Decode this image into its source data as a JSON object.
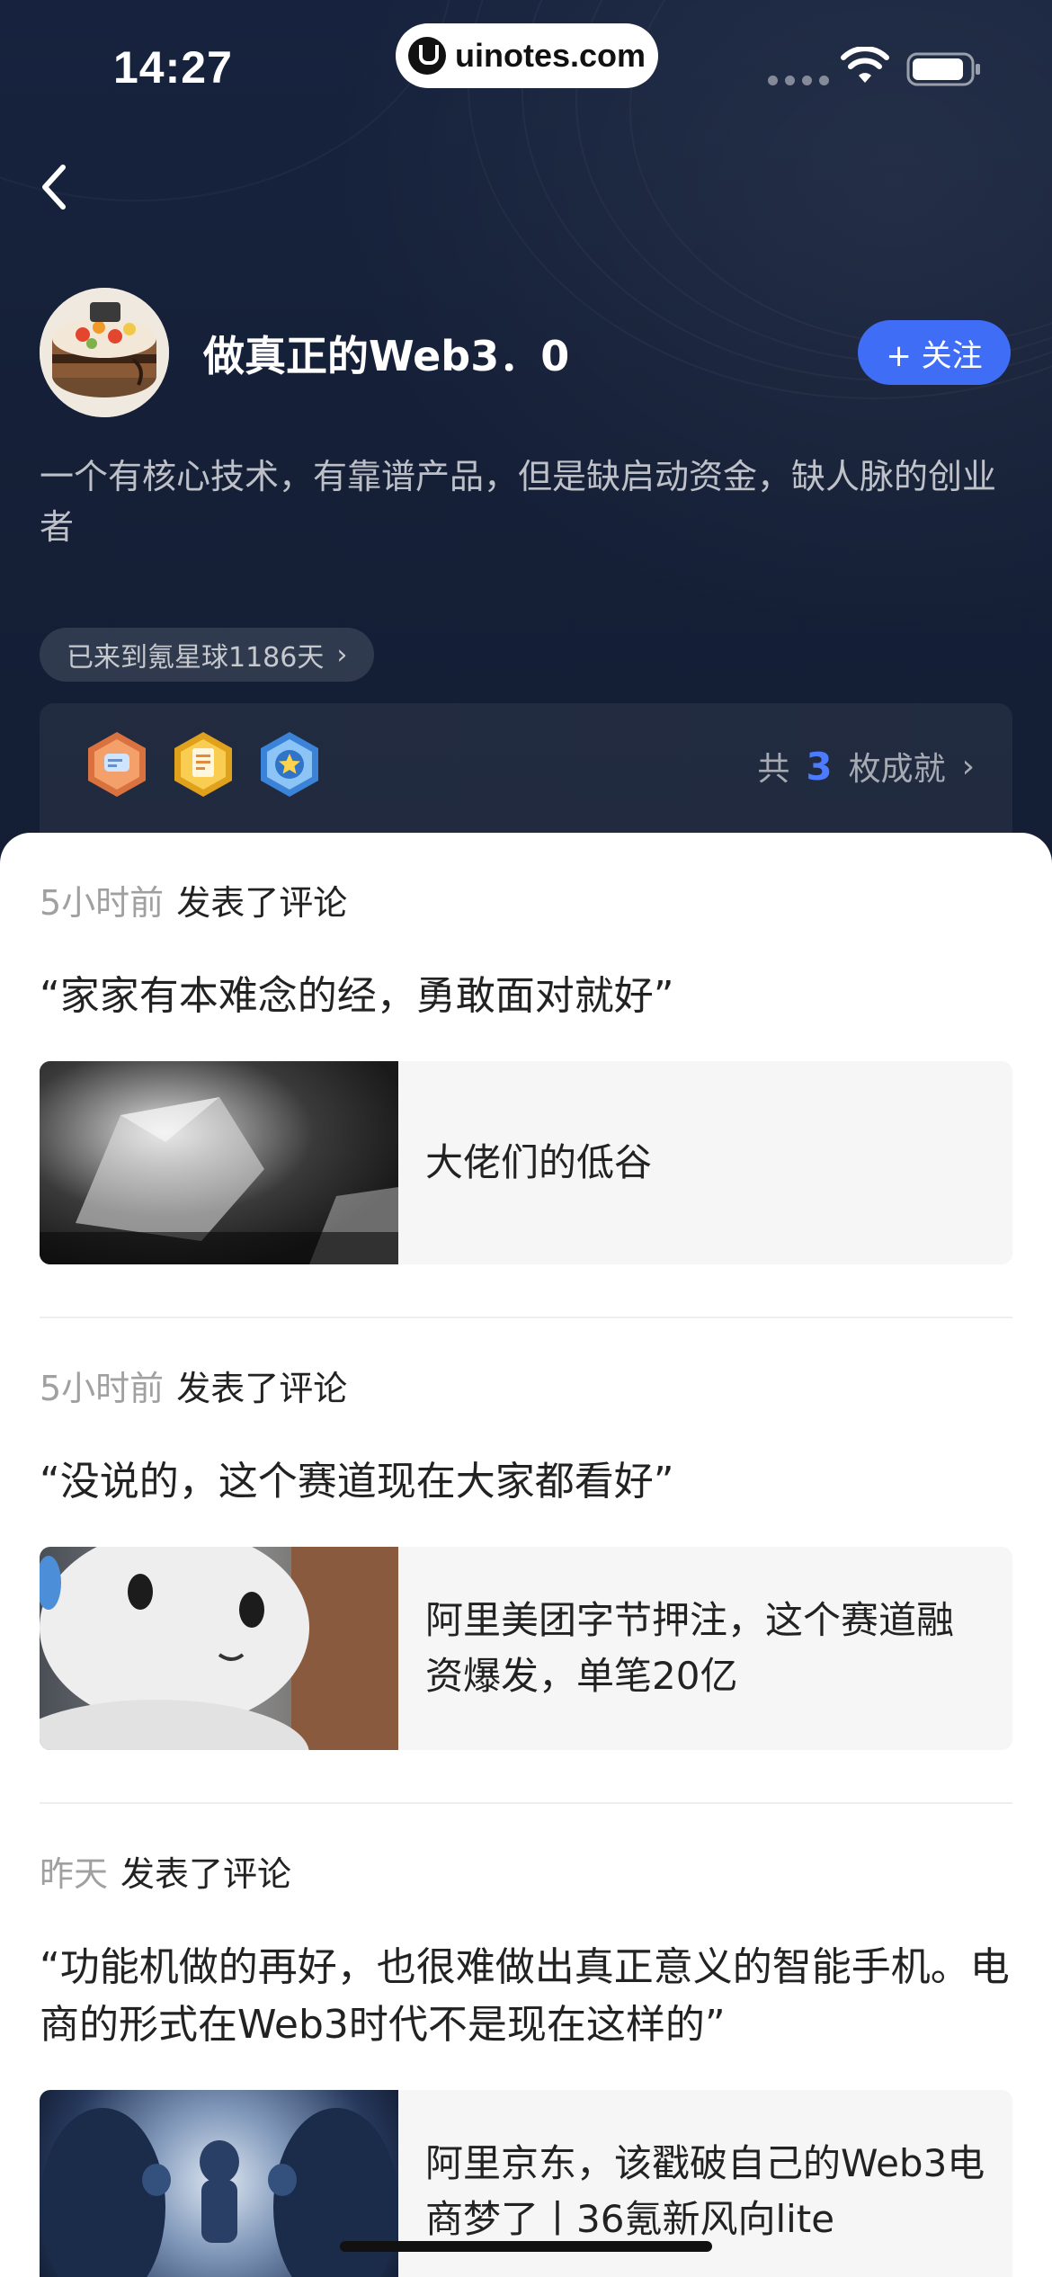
{
  "status_bar": {
    "time": "14:27",
    "watermark": "uinotes.com"
  },
  "profile": {
    "name": "做真正的Web3．0",
    "follow_label": "+ 关注",
    "bio": "一个有核心技术，有靠谱产品，但是缺启动资金，缺人脉的创业者",
    "days_label": "已来到氪星球1186天",
    "achievements": {
      "prefix": "共",
      "count": "3",
      "suffix": "枚成就",
      "badges": [
        "chat-badge-icon",
        "document-badge-icon",
        "star-badge-icon"
      ]
    }
  },
  "feed": [
    {
      "time": "5小时前",
      "action": "发表了评论",
      "comment": "“家家有本难念的经，勇敢面对就好”",
      "article_title": "大佬们的低谷",
      "thumb": "ice-image"
    },
    {
      "time": "5小时前",
      "action": "发表了评论",
      "comment": "“没说的，这个赛道现在大家都看好”",
      "article_title": "阿里美团字节押注，这个赛道融资爆发，单笔20亿",
      "thumb": "robot-image"
    },
    {
      "time": "昨天",
      "action": "发表了评论",
      "comment": "“功能机做的再好，也很难做出真正意义的智能手机。电商的形式在Web3时代不是现在这样的”",
      "article_title": "阿里京东，该戳破自己的Web3电商梦了丨36氪新风向lite",
      "thumb": "runners-image"
    }
  ],
  "colors": {
    "header_bg": "#152038",
    "accent": "#3f6df5",
    "count_blue": "#4d7bff"
  }
}
